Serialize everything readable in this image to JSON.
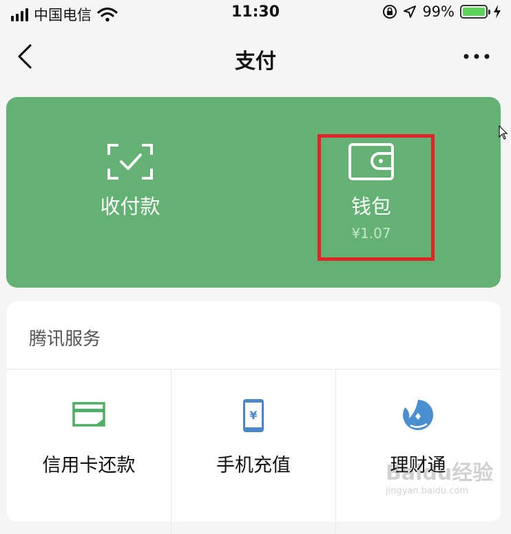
{
  "status_bar": {
    "carrier": "中国电信",
    "time": "11:30",
    "battery": "99%",
    "battery_level": 0.99,
    "icons": [
      "signal-icon",
      "wifi-icon",
      "orientation-lock-icon",
      "location-icon",
      "battery-icon",
      "charging-icon"
    ]
  },
  "nav": {
    "title": "支付",
    "icons": [
      "back-arrow-icon",
      "more-icon"
    ]
  },
  "pay_card": {
    "bg_color": "#64b174",
    "receive_label": "收付款",
    "wallet_label": "钱包",
    "wallet_balance": "¥1.07",
    "highlight_color": "#e2232a"
  },
  "services": {
    "title": "腾讯服务",
    "items": [
      {
        "label": "信用卡还款",
        "icon": "credit-card-icon",
        "color": "#4caf62"
      },
      {
        "label": "手机充值",
        "icon": "phone-recharge-icon",
        "color": "#4a86c8"
      },
      {
        "label": "理财通",
        "icon": "licaitong-icon",
        "color": "#4a90d0"
      }
    ]
  },
  "watermark": {
    "text": "Baidu经验",
    "url": "jingyan.baidu.com"
  }
}
